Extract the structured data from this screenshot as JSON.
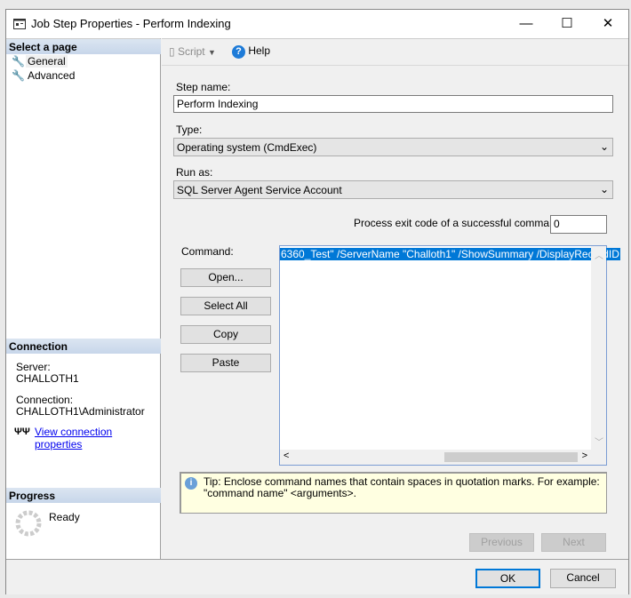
{
  "window": {
    "title": "Job Step Properties - Perform Indexing",
    "minimize": "—",
    "maximize": "☐",
    "close": "✕"
  },
  "sidebar": {
    "select_page_header": "Select a page",
    "pages": [
      {
        "label": "General",
        "icon": "wrench-icon"
      },
      {
        "label": "Advanced",
        "icon": "wrench-icon"
      }
    ],
    "connection_header": "Connection",
    "server_label": "Server:",
    "server_value": "CHALLOTH1",
    "connection_label": "Connection:",
    "connection_value": "CHALLOTH1\\Administrator",
    "view_connection_link": "View connection properties",
    "progress_header": "Progress",
    "progress_status": "Ready"
  },
  "toolbar": {
    "script_label": "Script",
    "help_label": "Help"
  },
  "form": {
    "step_name_label": "Step name:",
    "step_name_value": "Perform Indexing",
    "type_label": "Type:",
    "type_value": "Operating system (CmdExec)",
    "run_as_label": "Run as:",
    "run_as_value": "SQL Server Agent Service Account",
    "exit_code_label": "Process exit code of a successful command:",
    "exit_code_value": "0",
    "command_label": "Command:",
    "command_value": "6360_Test\" /ServerName \"Challoth1\" /ShowSummary /DisplayRecordID",
    "open_button": "Open...",
    "select_all_button": "Select All",
    "copy_button": "Copy",
    "paste_button": "Paste",
    "tip": "Tip: Enclose command names that contain spaces in quotation marks. For example: \"command name\" <arguments>.",
    "previous_button": "Previous",
    "next_button": "Next"
  },
  "footer": {
    "ok_button": "OK",
    "cancel_button": "Cancel"
  }
}
